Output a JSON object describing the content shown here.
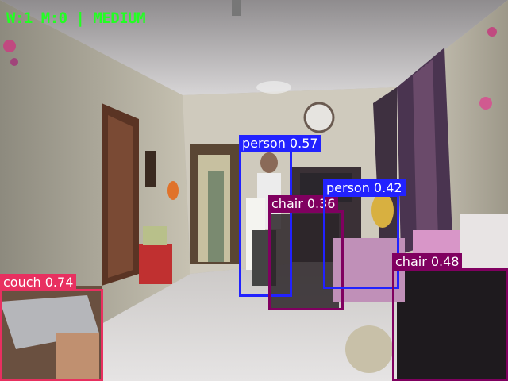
{
  "hud": {
    "status_text": "W:1 M:0 | MEDIUM",
    "color": "#22ff22"
  },
  "detections": [
    {
      "label": "person 0.57",
      "class": "person",
      "confidence": 0.57,
      "color": "#2222ff"
    },
    {
      "label": "chair 0.36",
      "class": "chair",
      "confidence": 0.36,
      "color": "#800060"
    },
    {
      "label": "person 0.42",
      "class": "person",
      "confidence": 0.42,
      "color": "#2222ff"
    },
    {
      "label": "chair 0.48",
      "class": "chair",
      "confidence": 0.48,
      "color": "#800060"
    },
    {
      "label": "couch 0.74",
      "class": "couch",
      "confidence": 0.74,
      "color": "#e83060"
    }
  ]
}
